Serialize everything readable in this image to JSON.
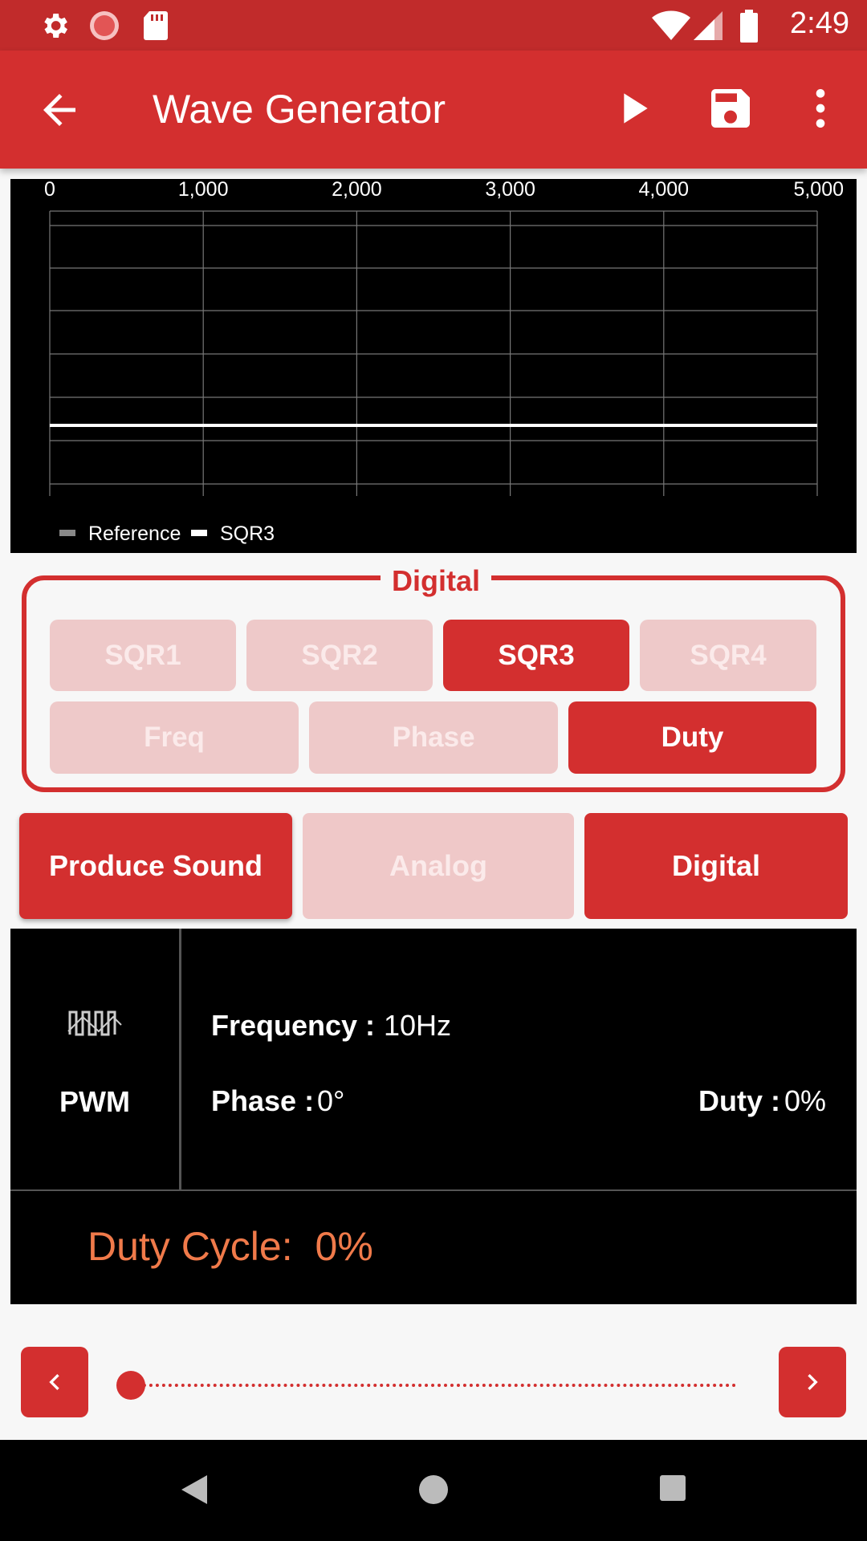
{
  "status_bar": {
    "time": "2:49",
    "icons": [
      "settings-icon",
      "record-icon",
      "sd-card-icon",
      "wifi-icon",
      "signal-icon",
      "battery-icon"
    ]
  },
  "app_bar": {
    "title": "Wave Generator",
    "actions": [
      "play-icon",
      "save-icon",
      "more-vert-icon"
    ]
  },
  "chart_data": {
    "type": "line",
    "x_ticks": [
      "0",
      "1,000",
      "2,000",
      "3,000",
      "4,000",
      "5,000"
    ],
    "xlim": [
      0,
      5000
    ],
    "series": [
      {
        "name": "Reference",
        "color": "#888888",
        "values": []
      },
      {
        "name": "SQR3",
        "color": "#ffffff",
        "x": [
          0,
          5000
        ],
        "y": [
          0,
          0
        ]
      }
    ],
    "grid": true,
    "legend": "bottom-left"
  },
  "digital_panel": {
    "label": "Digital",
    "channels": [
      {
        "label": "SQR1",
        "active": false
      },
      {
        "label": "SQR2",
        "active": false
      },
      {
        "label": "SQR3",
        "active": true
      },
      {
        "label": "SQR4",
        "active": false
      }
    ],
    "params": [
      {
        "label": "Freq",
        "active": false
      },
      {
        "label": "Phase",
        "active": false
      },
      {
        "label": "Duty",
        "active": true
      }
    ]
  },
  "modes": {
    "produce_sound": "Produce Sound",
    "analog": "Analog",
    "digital": "Digital"
  },
  "info": {
    "wave_label": "PWM",
    "frequency_label": "Frequency :",
    "frequency_value": "10Hz",
    "phase_label": "Phase :",
    "phase_value": "0°",
    "duty_label": "Duty :",
    "duty_value": "0%"
  },
  "duty_cycle": {
    "label": "Duty Cycle:",
    "value": "0%"
  },
  "slider": {
    "value_percent": 0
  },
  "colors": {
    "accent": "#d32f2f",
    "status_bar": "#c12b2b",
    "inactive": "#eec9c9",
    "duty_text": "#f07a4a"
  }
}
